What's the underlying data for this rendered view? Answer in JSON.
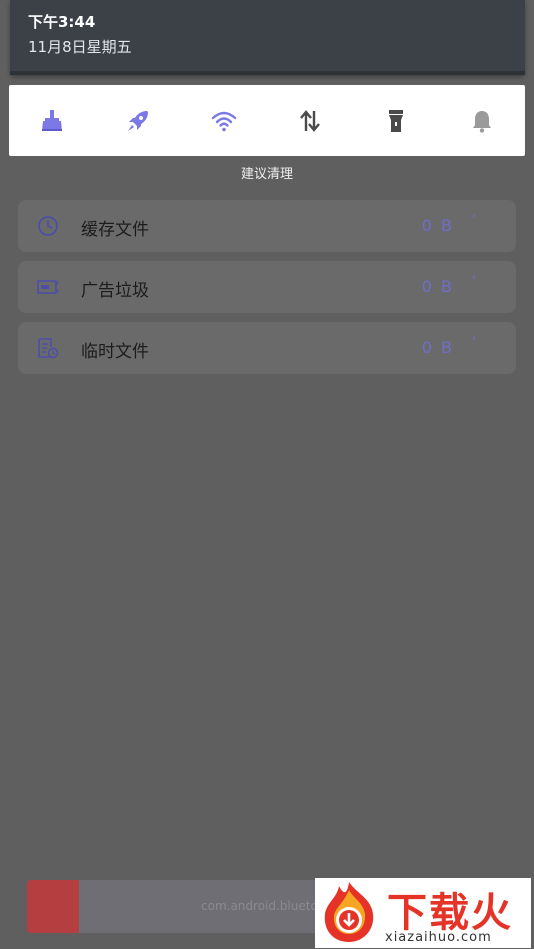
{
  "status": {
    "time": "下午3:44",
    "date": "11月8日星期五"
  },
  "quick_actions": [
    {
      "icon": "broom-clean-icon"
    },
    {
      "icon": "rocket-boost-icon"
    },
    {
      "icon": "wifi-icon"
    },
    {
      "icon": "data-transfer-icon"
    },
    {
      "icon": "flashlight-icon"
    },
    {
      "icon": "bell-icon"
    }
  ],
  "section": {
    "title": "建议清理"
  },
  "junk_items": [
    {
      "label": "缓存文件",
      "size": "0 B",
      "icon": "clock-icon"
    },
    {
      "label": "广告垃圾",
      "size": "0 B",
      "icon": "ad-icon"
    },
    {
      "label": "临时文件",
      "size": "0 B",
      "icon": "temp-file-icon"
    }
  ],
  "spinner_glyph": "ʹ",
  "bottom_bar": {
    "text": "com.android.blueto"
  },
  "watermark": {
    "text": "下载火",
    "url": "xiazaihuo.com"
  },
  "colors": {
    "accent": "#7b79e6",
    "watermark_red": "#e53427",
    "panel": "#3b4147"
  }
}
